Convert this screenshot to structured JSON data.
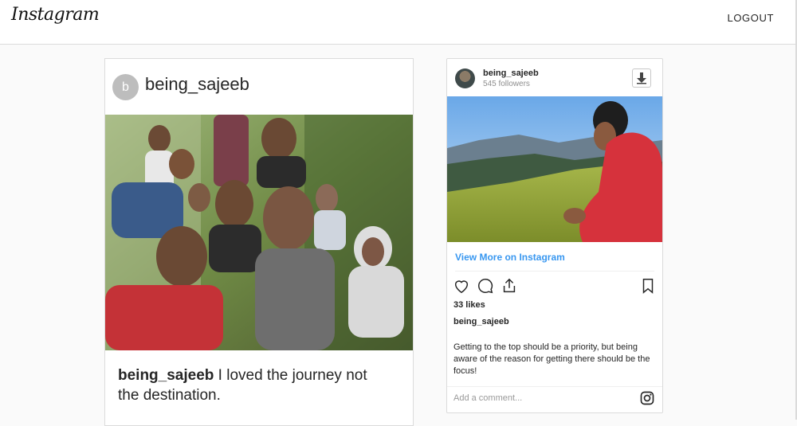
{
  "nav": {
    "logo_text": "Instagram",
    "logout_label": "LOGOUT"
  },
  "left_post": {
    "avatar_letter": "b",
    "username": "being_sajeeb",
    "caption_user": "being_sajeeb",
    "caption_text": " I loved the journey not the destination."
  },
  "embed": {
    "username": "being_sajeeb",
    "followers": "545 followers",
    "view_more": "View More on Instagram",
    "likes": "33 likes",
    "caption_user": "being_sajeeb",
    "caption": "Getting to the top should be a priority, but being aware of the reason for getting there should be the focus!",
    "comment_placeholder": "Add a comment..."
  },
  "icons": [
    "download-icon",
    "heart-icon",
    "comment-icon",
    "share-icon",
    "bookmark-icon",
    "instagram-glyph-icon"
  ],
  "colors": {
    "link_blue": "#3897f0",
    "border": "#dbdbdb",
    "muted": "#8e8e8e"
  }
}
